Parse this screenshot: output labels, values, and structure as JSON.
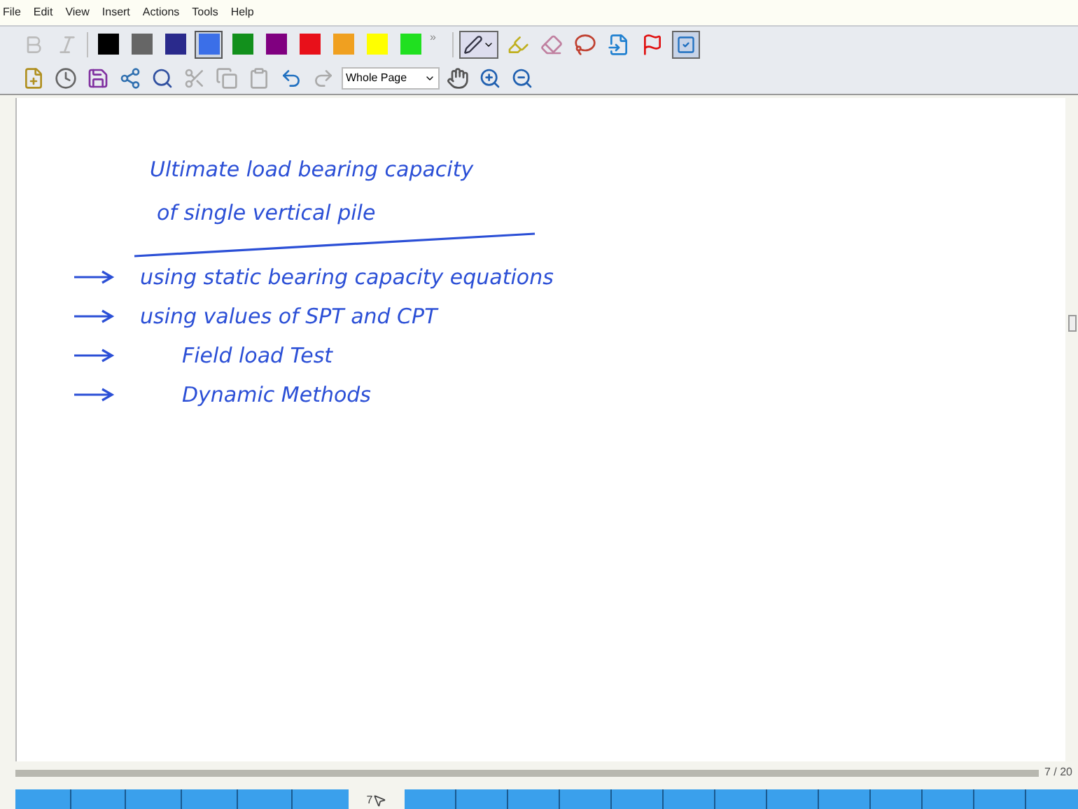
{
  "menu": [
    "File",
    "Edit",
    "View",
    "Insert",
    "Actions",
    "Tools",
    "Help"
  ],
  "palette": [
    {
      "color": "#000000",
      "selected": false
    },
    {
      "color": "#666666",
      "selected": false
    },
    {
      "color": "#2a2a8c",
      "selected": false
    },
    {
      "color": "#3b6fe8",
      "selected": true
    },
    {
      "color": "#12901c",
      "selected": false
    },
    {
      "color": "#800080",
      "selected": false
    },
    {
      "color": "#e8101a",
      "selected": false
    },
    {
      "color": "#f0a020",
      "selected": false
    },
    {
      "color": "#ffff00",
      "selected": false
    },
    {
      "color": "#20e020",
      "selected": false
    }
  ],
  "overflow": "»",
  "zoom_select": {
    "value": "Whole Page"
  },
  "note": {
    "title": [
      "Ultimate load bearing capacity",
      "of single vertical pile"
    ],
    "items": [
      {
        "text": "using static bearing capacity equations",
        "indented": false
      },
      {
        "text": "using values of SPT and CPT",
        "indented": false
      },
      {
        "text": "Field load Test",
        "indented": true
      },
      {
        "text": "Dynamic Methods",
        "indented": true
      }
    ]
  },
  "page_indicator": "7 / 20",
  "strip_label": "7"
}
